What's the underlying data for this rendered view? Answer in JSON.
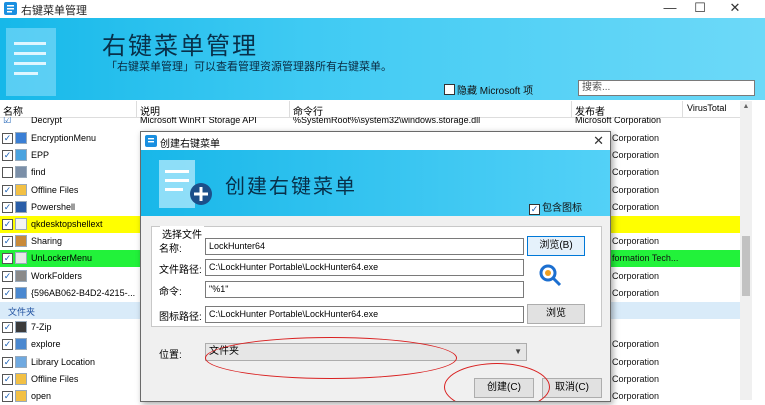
{
  "window": {
    "title": "右键菜单管理",
    "minimize": "—",
    "maximize": "☐",
    "close": "✕"
  },
  "header": {
    "big_title": "右键菜单管理",
    "subtitle": "「右键菜单管理」可以查看管理资源管理器所有右键菜单。",
    "hide_ms_label": "隐藏 Microsoft 项",
    "search_placeholder": "搜索..."
  },
  "columns": {
    "name": "名称",
    "desc": "说明",
    "cmd": "命令行",
    "publisher": "发布者",
    "vt": "VirusTotal"
  },
  "top_partial_row": {
    "name": "Decrypt",
    "desc": "Microsoft WinRT Storage API",
    "cmd": "%SystemRoot%\\system32\\windows.storage.dll",
    "publisher": "Microsoft Corporation"
  },
  "rows": [
    {
      "name": "EncryptionMenu",
      "checked": true,
      "publisher": "Corporation"
    },
    {
      "name": "EPP",
      "checked": true,
      "publisher": "Corporation"
    },
    {
      "name": "find",
      "checked": false,
      "publisher": "Corporation"
    },
    {
      "name": "Offline Files",
      "checked": true,
      "publisher": "Corporation"
    },
    {
      "name": "Powershell",
      "checked": true,
      "publisher": "Corporation"
    },
    {
      "name": "qkdesktopshellext",
      "checked": true,
      "publisher": ""
    },
    {
      "name": "Sharing",
      "checked": true,
      "publisher": "Corporation"
    },
    {
      "name": "UnLockerMenu",
      "checked": true,
      "publisher": "formation Tech..."
    },
    {
      "name": "WorkFolders",
      "checked": true,
      "publisher": "Corporation"
    },
    {
      "name": "{596AB062-B4D2-4215-...",
      "checked": true,
      "publisher": "Corporation"
    },
    {
      "name": "文件夹",
      "category": true,
      "publisher": ""
    },
    {
      "name": "7-Zip",
      "checked": true,
      "publisher": ""
    },
    {
      "name": "explore",
      "checked": true,
      "publisher": "Corporation"
    },
    {
      "name": "Library Location",
      "checked": true,
      "publisher": "Corporation"
    },
    {
      "name": "Offline Files",
      "checked": true,
      "publisher": "Corporation"
    },
    {
      "name": "open",
      "checked": true,
      "publisher": "Corporation"
    }
  ],
  "dialog": {
    "title": "创建右键菜单",
    "close": "✕",
    "big_title": "创建右键菜单",
    "include_icon_label": "包含图标",
    "group_title": "选择文件",
    "name_label": "名称:",
    "name_value": "LockHunter64",
    "browse_label": "浏览(B)",
    "path_label": "文件路径:",
    "path_value": "C:\\LockHunter Portable\\LockHunter64.exe",
    "cmd_label": "命令:",
    "cmd_value": "\"%1\"",
    "icon_path_label": "图标路径:",
    "icon_path_value": "C:\\LockHunter Portable\\LockHunter64.exe",
    "icon_browse_label": "浏览",
    "position_label": "位置:",
    "position_value": "文件夹",
    "create_label": "创建(C)",
    "cancel_label": "取消(C)"
  },
  "colors": {
    "accent": "#16b8e9",
    "highlight_yellow": "#ffff00",
    "highlight_green": "#22f23a",
    "annotation_red": "#d92020"
  }
}
